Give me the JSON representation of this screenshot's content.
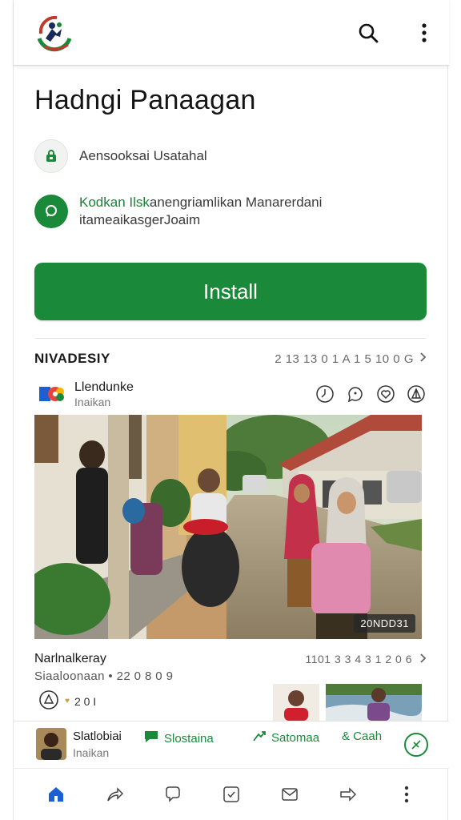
{
  "header": {
    "logo_icon": "app-logo-icon",
    "search_icon": "search-icon",
    "menu_icon": "more-vertical-icon"
  },
  "app": {
    "title": "Hadngi Panaagan",
    "info_1": "Aensooksai Usatahal",
    "info_2_highlight": "Kodkan Ilsk",
    "info_2_rest": "anengriamlikan Manarerdani",
    "info_2_line2": "itameaikasgerJoaim",
    "install_label": "Install"
  },
  "section": {
    "title": "NIVADESIY",
    "meta": "2 13 13 0 1 A 1 5 10 0 G"
  },
  "post": {
    "name": "Llendunke",
    "sub": "Inaikan",
    "photo_badge": "20NDD31",
    "caption_title": "Narlnalkeray",
    "caption_meta": "1101 3 3 4 3 1 2 0 6",
    "caption_sub": "Siaaloonaan • 22 0 8 0 9",
    "stats_value": "2 0 I"
  },
  "author": {
    "name": "Slatlobiai",
    "sub": "Inaikan",
    "action_1": "Slostaina",
    "action_2": "Satomaa",
    "action_3": "& Caah"
  },
  "nav": {
    "items": [
      "home-icon",
      "share-icon",
      "chat-icon",
      "inbox-icon",
      "mail-icon",
      "forward-icon",
      "more-icon"
    ]
  },
  "colors": {
    "primary": "#1a8a3a",
    "text": "#1a1a1a",
    "muted": "#6a6a6a",
    "home_icon": "#1a5fd4"
  }
}
